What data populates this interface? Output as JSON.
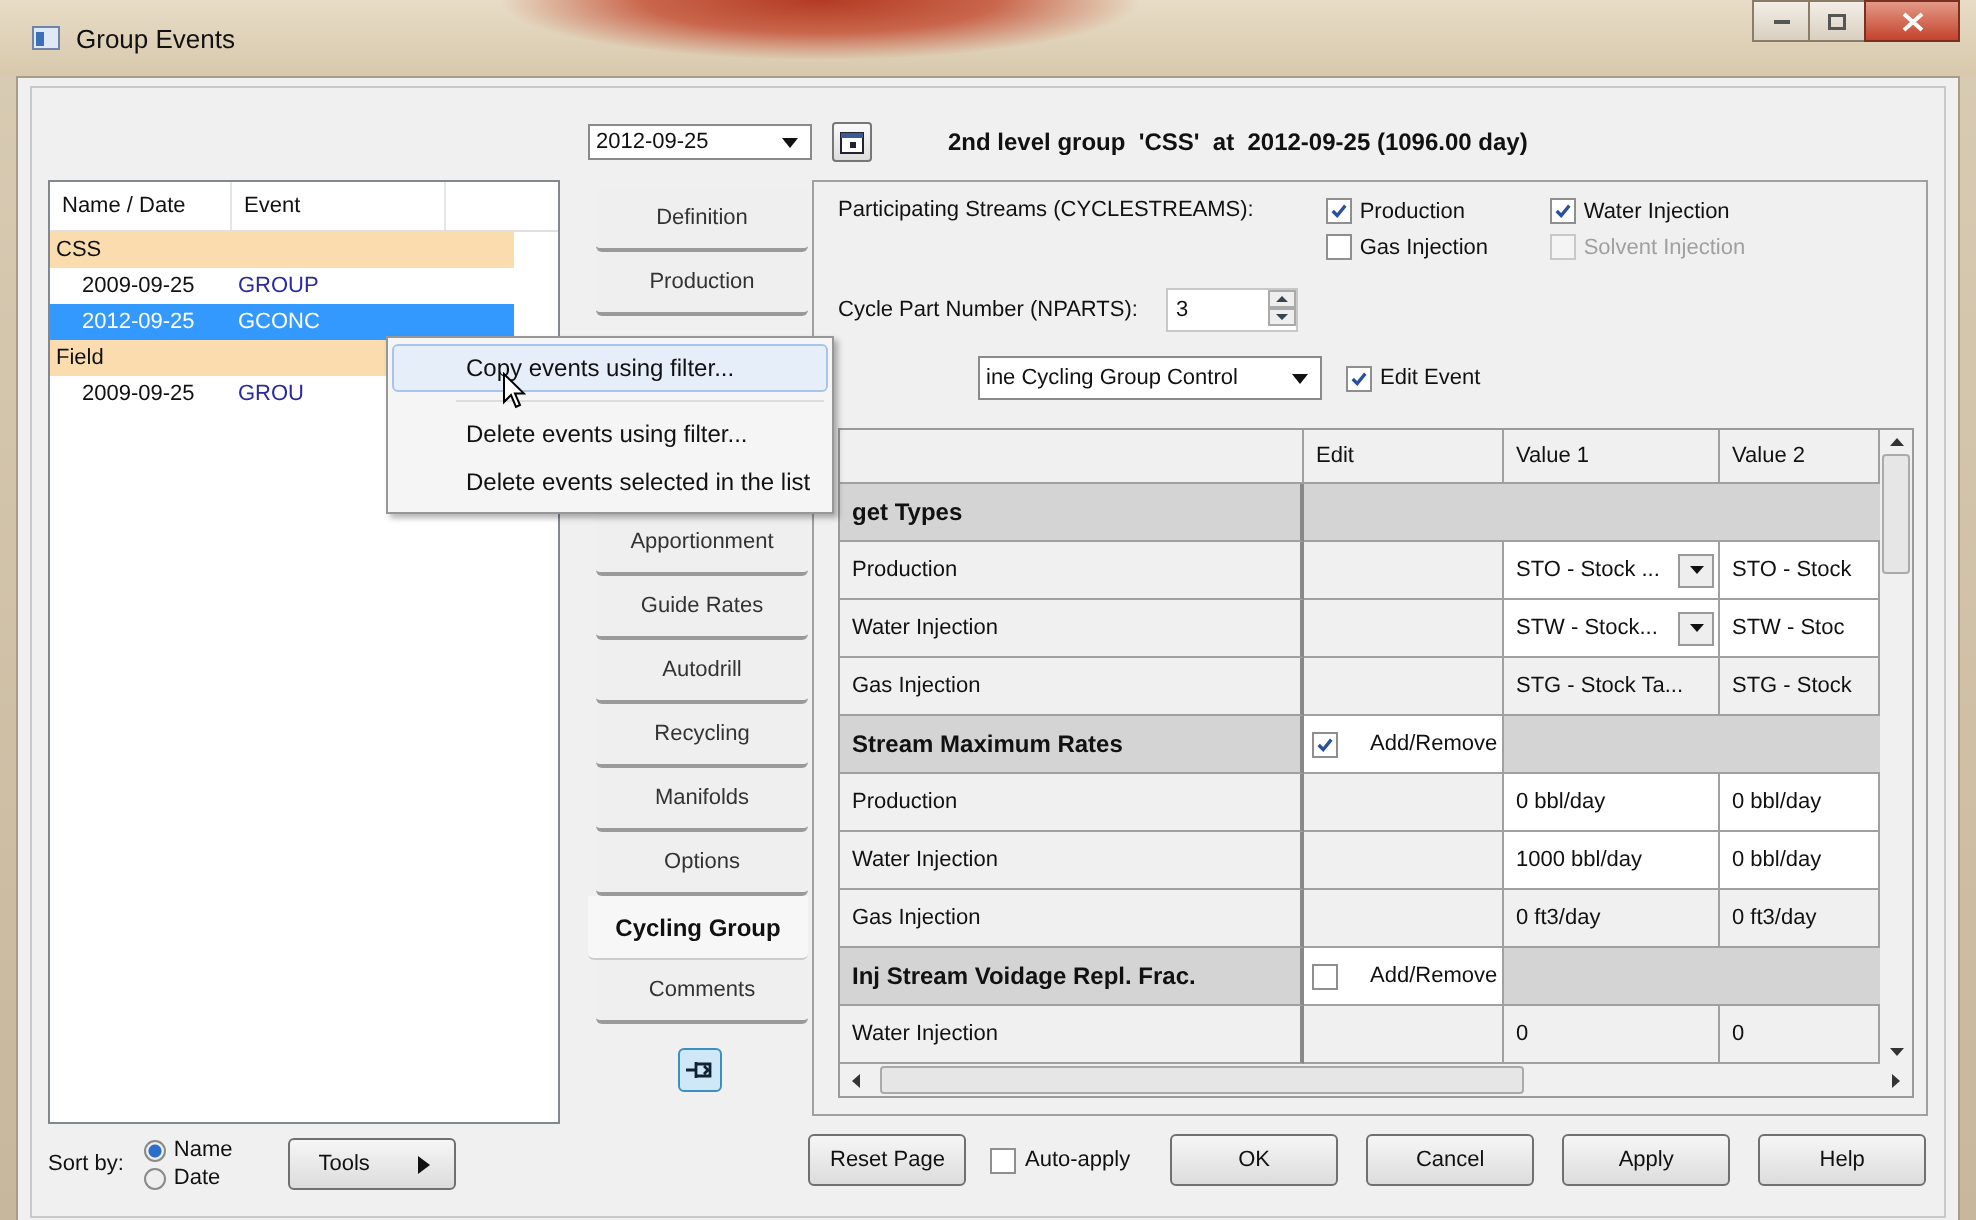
{
  "window": {
    "title": "Group Events"
  },
  "event_list": {
    "columns": [
      "Name / Date",
      "Event"
    ],
    "rows": [
      {
        "kind": "group",
        "name": "CSS",
        "selected": false
      },
      {
        "kind": "event",
        "date": "2009-09-25",
        "event": "GROUP",
        "selected": false
      },
      {
        "kind": "event",
        "date": "2012-09-25",
        "event": "GCONC",
        "selected": true
      },
      {
        "kind": "group",
        "name": "Field",
        "selected": false
      },
      {
        "kind": "event",
        "date": "2009-09-25",
        "event": "GROU",
        "selected": false
      }
    ]
  },
  "sort_by": {
    "label": "Sort by:",
    "options": [
      {
        "label": "Name",
        "selected": true
      },
      {
        "label": "Date",
        "selected": false
      }
    ]
  },
  "tools_button": "Tools",
  "context_menu": [
    {
      "label": "Copy events using filter...",
      "selected": true
    },
    {
      "label": "Delete events using filter...",
      "selected": false,
      "separator_before": true
    },
    {
      "label": "Delete events selected in the list",
      "selected": false
    }
  ],
  "date_combo": "2012-09-25",
  "header": "2nd level group  'CSS'  at  2012-09-25 (1096.00 day)",
  "tabs_top": [
    {
      "label": "Definition",
      "selected": false
    },
    {
      "label": "Production",
      "selected": false
    }
  ],
  "tabs_bottom": [
    {
      "label": "Apportionment",
      "selected": false
    },
    {
      "label": "Guide Rates",
      "selected": false
    },
    {
      "label": "Autodrill",
      "selected": false
    },
    {
      "label": "Recycling",
      "selected": false
    },
    {
      "label": "Manifolds",
      "selected": false
    },
    {
      "label": "Options",
      "selected": false
    },
    {
      "label": "Cycling Group",
      "selected": true
    },
    {
      "label": "Comments",
      "selected": false
    }
  ],
  "streams": {
    "label": "Participating Streams (CYCLESTREAMS):",
    "options": [
      {
        "label": "Production",
        "checked": true,
        "disabled": false
      },
      {
        "label": "Water Injection",
        "checked": true,
        "disabled": false
      },
      {
        "label": "Gas Injection",
        "checked": false,
        "disabled": false
      },
      {
        "label": "Solvent Injection",
        "checked": false,
        "disabled": true
      }
    ]
  },
  "nparts": {
    "label": "Cycle Part Number (NPARTS):",
    "value": "3"
  },
  "control_combo": "ine Cycling Group Control",
  "edit_event": {
    "label": "Edit Event",
    "checked": true
  },
  "grid": {
    "columns": [
      "Edit",
      "Value 1",
      "Value 2"
    ],
    "rows": [
      {
        "kind": "section",
        "label": "get Types"
      },
      {
        "kind": "item",
        "label": "Production",
        "editable": true,
        "dropdown": true,
        "values": [
          "STO - Stock ...",
          "STO - Stock"
        ]
      },
      {
        "kind": "item",
        "label": "Water Injection",
        "editable": true,
        "dropdown": true,
        "values": [
          "STW - Stock...",
          "STW - Stoc"
        ]
      },
      {
        "kind": "item",
        "label": "Gas Injection",
        "editable": false,
        "dropdown": false,
        "values": [
          "STG - Stock Ta...",
          "STG - Stock"
        ]
      },
      {
        "kind": "section",
        "label": "Stream Maximum Rates",
        "checked": true,
        "edit_label": "Add/Remove"
      },
      {
        "kind": "item",
        "label": "Production",
        "editable": true,
        "dropdown": false,
        "values": [
          "0 bbl/day",
          "0 bbl/day"
        ]
      },
      {
        "kind": "item",
        "label": "Water Injection",
        "editable": true,
        "dropdown": false,
        "values": [
          "1000 bbl/day",
          "0 bbl/day"
        ]
      },
      {
        "kind": "item",
        "label": "Gas Injection",
        "editable": false,
        "dropdown": false,
        "values": [
          "0 ft3/day",
          "0 ft3/day"
        ]
      },
      {
        "kind": "section",
        "label": "Inj Stream Voidage Repl. Frac.",
        "checked": false,
        "edit_label": "Add/Remove"
      },
      {
        "kind": "item",
        "label": "Water Injection",
        "editable": false,
        "dropdown": false,
        "values": [
          "0",
          "0"
        ]
      }
    ]
  },
  "buttons": {
    "reset": "Reset Page",
    "auto_apply": {
      "label": "Auto-apply",
      "checked": false
    },
    "actions": [
      "OK",
      "Cancel",
      "Apply",
      "Help"
    ]
  }
}
